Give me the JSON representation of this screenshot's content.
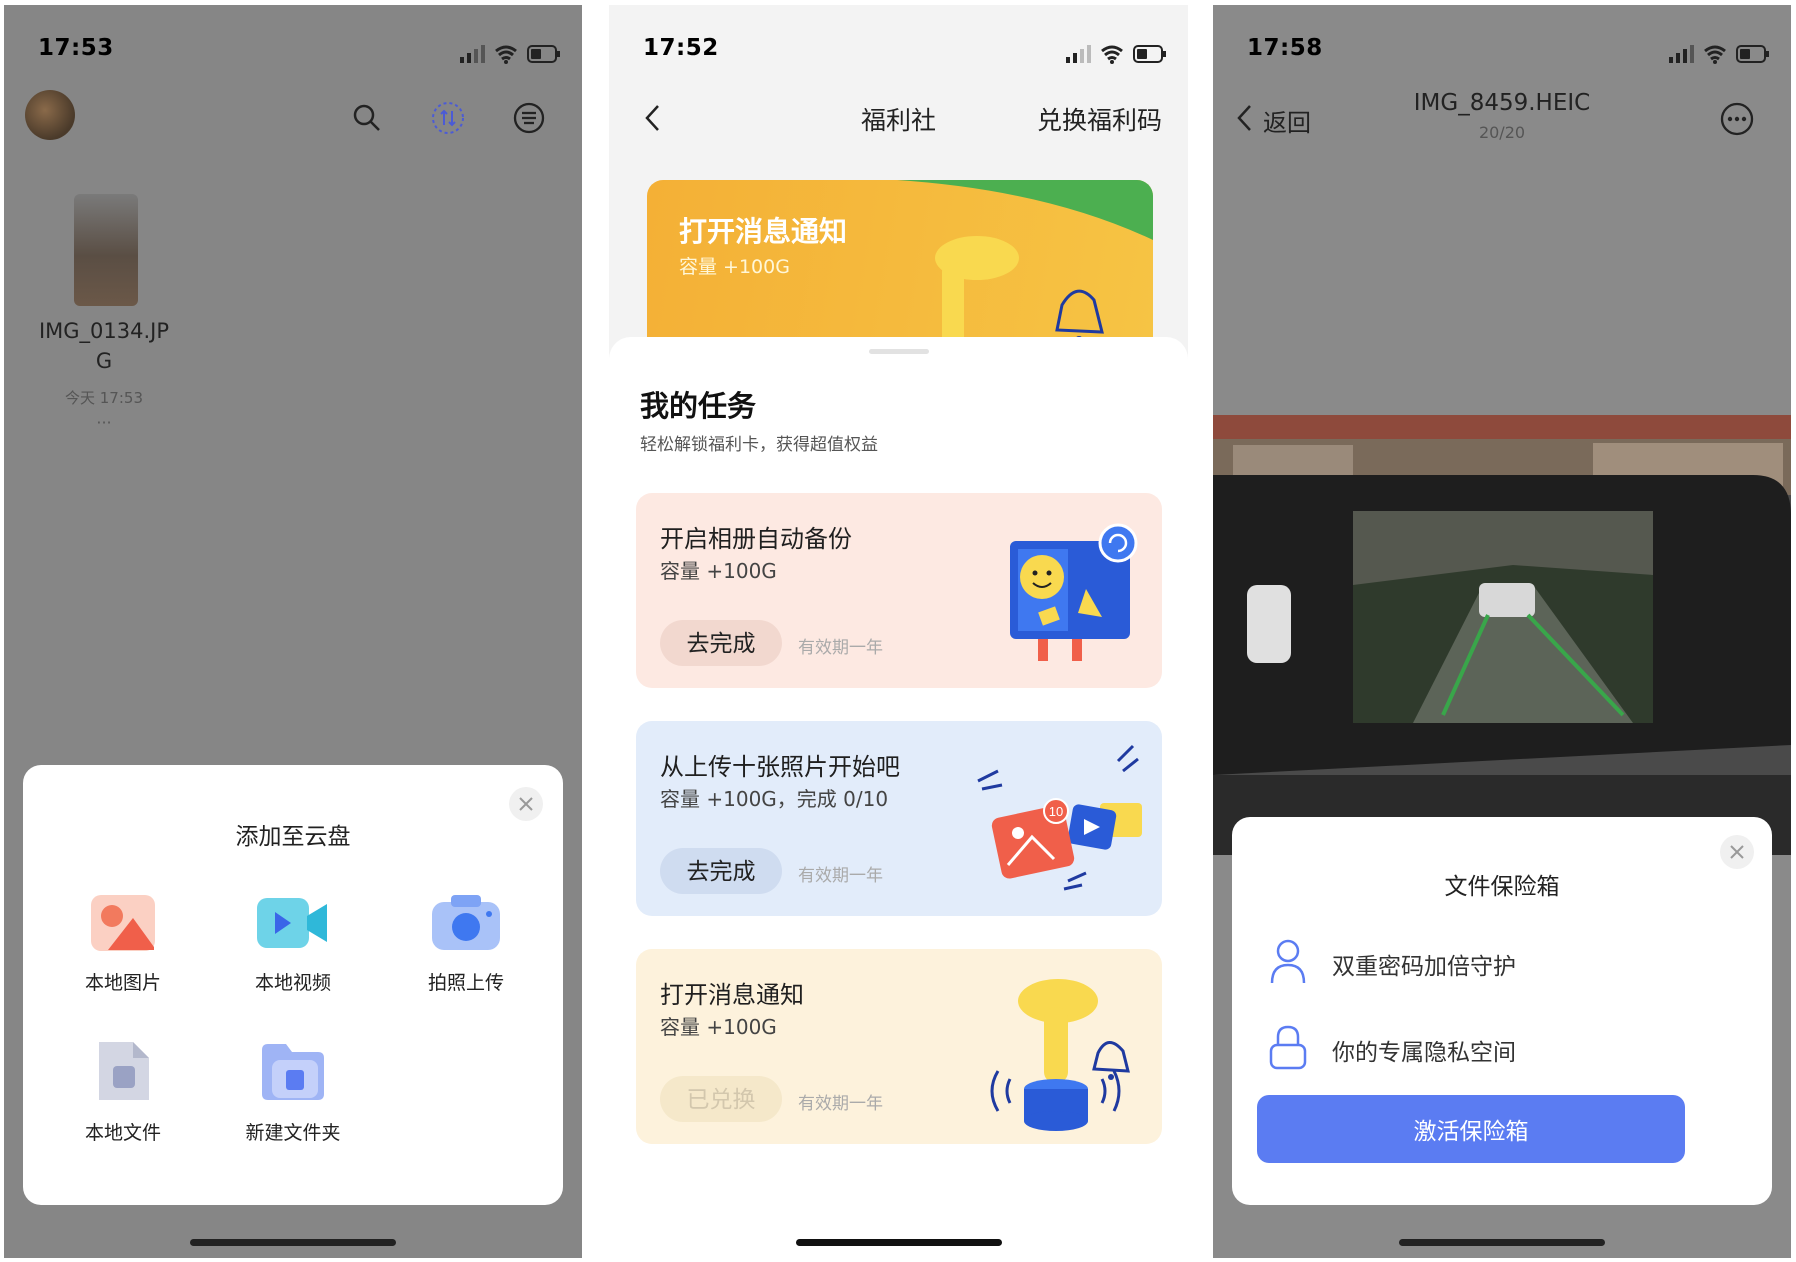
{
  "colors": {
    "accent": "#5b7cf2",
    "card_pink": "#fde9e2",
    "card_blue": "#e2ecfa",
    "card_yellow": "#fdf2dc",
    "banner": "#f4b036"
  },
  "screen1": {
    "time": "17:53",
    "file": {
      "name_line1": "IMG_0134.JP",
      "name_line2": "G",
      "date": "今天 17:53",
      "more": "···"
    },
    "sheet": {
      "title": "添加至云盘",
      "items": [
        {
          "label": "本地图片",
          "icon": "photo-icon"
        },
        {
          "label": "本地视频",
          "icon": "video-icon"
        },
        {
          "label": "拍照上传",
          "icon": "camera-icon"
        },
        {
          "label": "本地文件",
          "icon": "file-icon"
        },
        {
          "label": "新建文件夹",
          "icon": "folder-icon"
        }
      ]
    }
  },
  "screen2": {
    "time": "17:52",
    "nav": {
      "title": "福利社",
      "action": "兑换福利码"
    },
    "banner": {
      "title": "打开消息通知",
      "subtitle": "容量 +100G"
    },
    "section": {
      "title": "我的任务",
      "subtitle": "轻松解锁福利卡，获得超值权益"
    },
    "cards": [
      {
        "title": "开启相册自动备份",
        "sub": "容量 +100G",
        "button": "去完成",
        "valid": "有效期一年"
      },
      {
        "title": "从上传十张照片开始吧",
        "sub": "容量 +100G，完成 0/10",
        "button": "去完成",
        "valid": "有效期一年",
        "badge": "10"
      },
      {
        "title": "打开消息通知",
        "sub": "容量 +100G",
        "button": "已兑换",
        "valid": "有效期一年"
      }
    ]
  },
  "screen3": {
    "time": "17:58",
    "nav": {
      "back": "返回",
      "title": "IMG_8459.HEIC",
      "counter": "20/20"
    },
    "sheet": {
      "title": "文件保险箱",
      "features": [
        {
          "text": "双重密码加倍守护",
          "icon": "user-icon"
        },
        {
          "text": "你的专属隐私空间",
          "icon": "lock-icon"
        }
      ],
      "button": "激活保险箱"
    }
  }
}
